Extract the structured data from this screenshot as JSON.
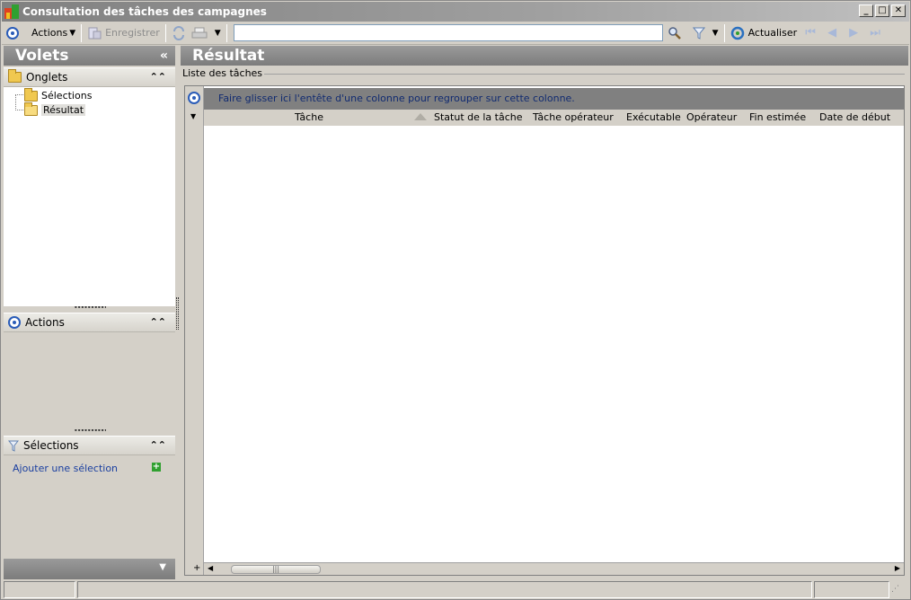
{
  "window": {
    "title": "Consultation des tâches des campagnes",
    "buttons": [
      "_",
      "□",
      "✕"
    ]
  },
  "toolbar": {
    "actions_label": "Actions",
    "save_label": "Enregistrer",
    "search_value": "",
    "refresh_label": "Actualiser"
  },
  "left_pane": {
    "title": "Volets",
    "collapse_glyph": "«",
    "tabs_section": {
      "title": "Onglets",
      "items": [
        "Sélections",
        "Résultat"
      ]
    },
    "actions_section": {
      "title": "Actions"
    },
    "selections_section": {
      "title": "Sélections",
      "add_link": "Ajouter une sélection"
    }
  },
  "right_pane": {
    "title": "Résultat",
    "group_caption": "Liste des tâches",
    "grid": {
      "drop_hint": "Faire glisser ici l'entête d'une colonne pour regrouper sur cette colonne.",
      "columns": [
        "Tâche",
        "Statut de la tâche",
        "Tâche opérateur",
        "Exécutable",
        "Opérateur",
        "Fin estimée",
        "Date de début"
      ],
      "rows": []
    }
  }
}
